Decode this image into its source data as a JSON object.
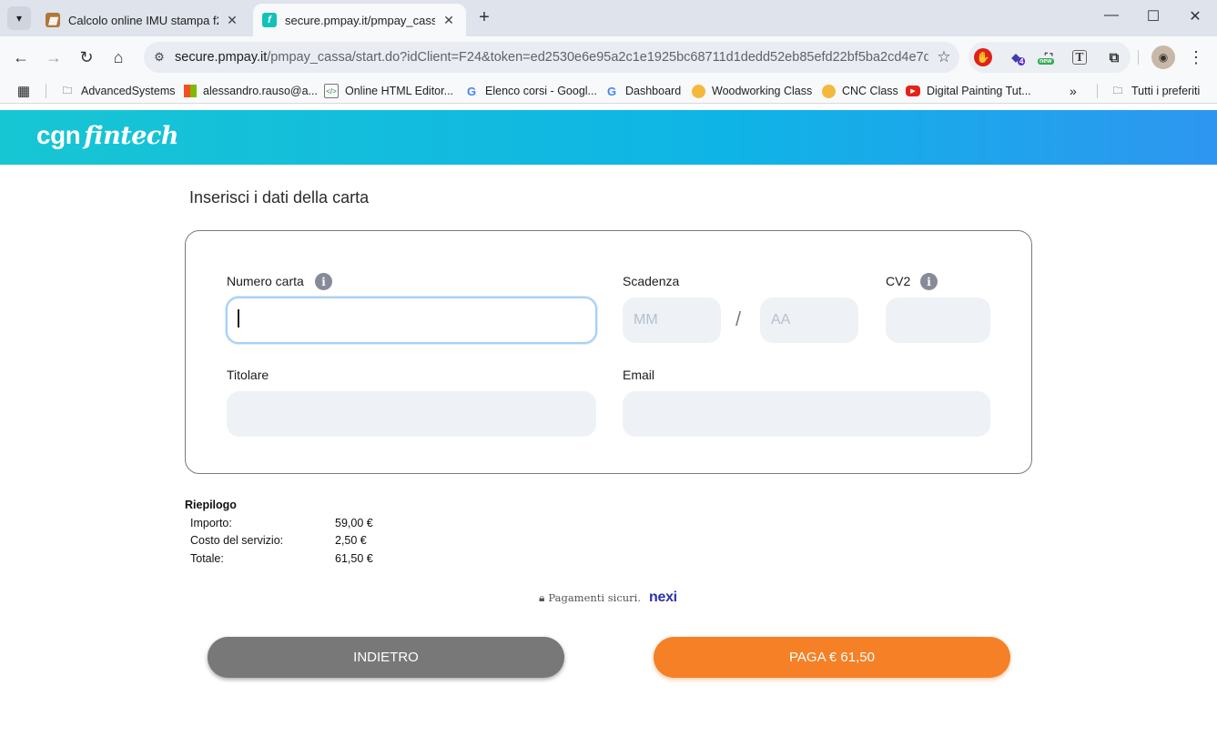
{
  "browser": {
    "tabs": [
      {
        "title": "Calcolo online IMU stampa f24",
        "active": false
      },
      {
        "title": "secure.pmpay.it/pmpay_cassa/s",
        "active": true
      }
    ],
    "url": {
      "host": "secure.pmpay.it",
      "path": "/pmpay_cassa/start.do?idClient=F24&token=ed2530e6e95a2c1e1925bc68711d1dedd52eb85efd22bf5ba2cd4e7d6..."
    },
    "extensions": {
      "badge_count": "4",
      "new_label": "new"
    },
    "bookmarks": [
      {
        "label": "AdvancedSystems",
        "icon": "folder-icon"
      },
      {
        "label": "alessandro.rauso@a...",
        "icon": "microsoft-icon"
      },
      {
        "label": "Online HTML Editor...",
        "icon": "code-icon"
      },
      {
        "label": "Elenco corsi - Googl...",
        "icon": "google-icon"
      },
      {
        "label": "Dashboard",
        "icon": "google-icon"
      },
      {
        "label": "Woodworking Class",
        "icon": "emoji-icon"
      },
      {
        "label": "CNC Class",
        "icon": "emoji-icon"
      },
      {
        "label": "Digital Painting Tut...",
        "icon": "youtube-icon"
      }
    ],
    "overflow_label": "»",
    "all_bookmarks": "Tutti i preferiti"
  },
  "brand": {
    "logo_main": "cgn",
    "logo_sub": "fintech"
  },
  "form": {
    "title": "Inserisci i dati della carta",
    "card_number_label": "Numero carta",
    "expiry_label": "Scadenza",
    "month_placeholder": "MM",
    "separator": "/",
    "year_placeholder": "AA",
    "cvv_label": "CV2",
    "holder_label": "Titolare",
    "email_label": "Email",
    "info_glyph": "i"
  },
  "summary": {
    "title": "Riepilogo",
    "rows": [
      {
        "label": "Importo:",
        "value": "59,00 €"
      },
      {
        "label": "Costo del servizio:",
        "value": "2,50 €"
      },
      {
        "label": "Totale:",
        "value": "61,50 €"
      }
    ]
  },
  "secure": {
    "text": "Pagamenti sicuri.",
    "provider": "nexi"
  },
  "buttons": {
    "back": "INDIETRO",
    "pay": "PAGA € 61,50"
  },
  "colors": {
    "brand_gradient_start": "#17c6d3",
    "brand_gradient_end": "#2e96f0",
    "pay_button": "#f58025",
    "back_button": "#787878",
    "nexi": "#2d32aa"
  }
}
